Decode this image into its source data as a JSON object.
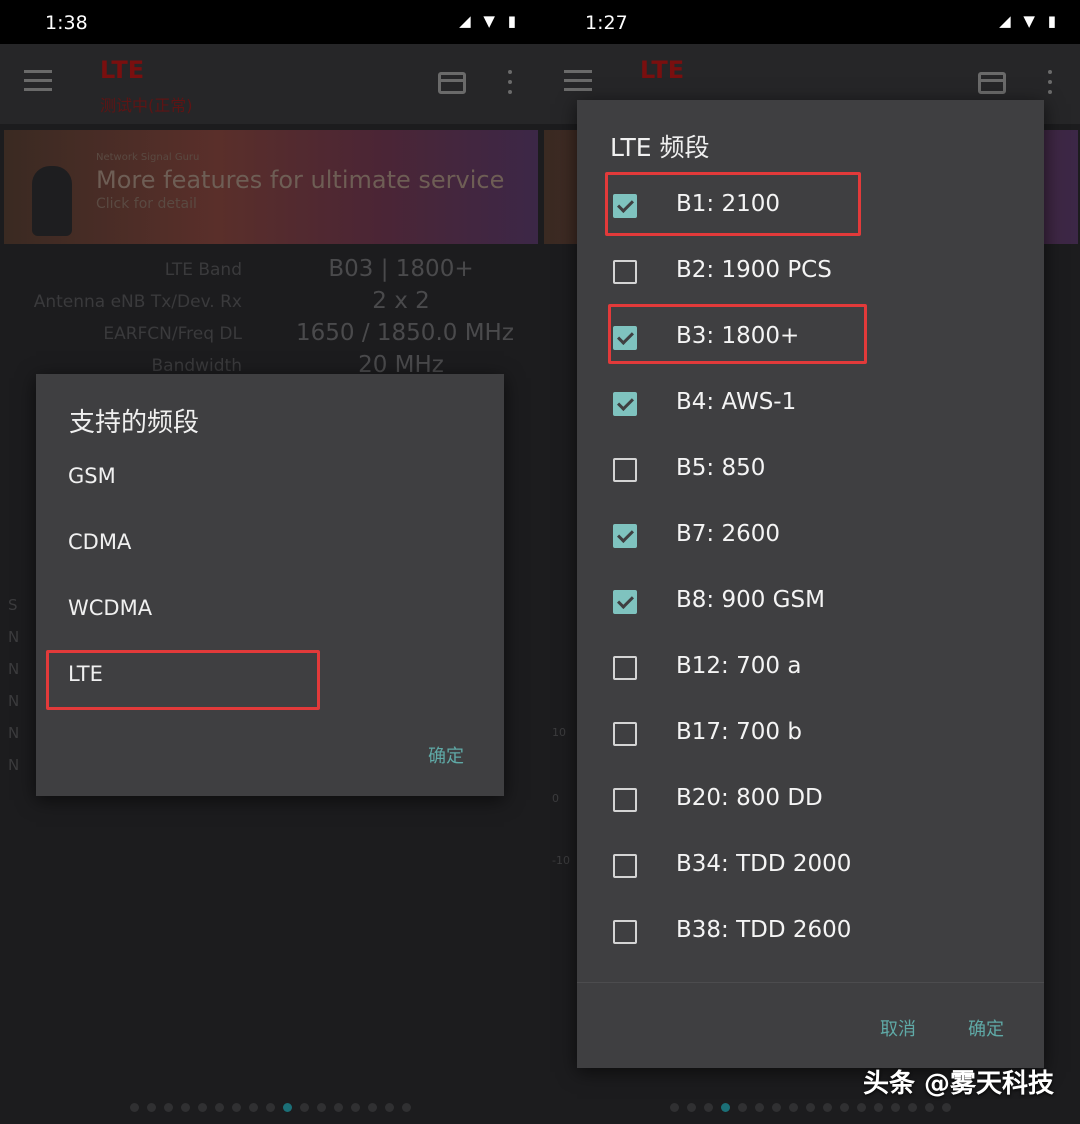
{
  "left": {
    "status": {
      "time": "1:38",
      "icons": "◢ ▼ ▮"
    },
    "appbar": {
      "title": "LTE",
      "subtitle": "测试中(正常)"
    },
    "banner": {
      "small": "Network Signal Guru",
      "main": "More features for ultimate service",
      "sub": "Click for detail"
    },
    "stats": [
      {
        "label": "LTE Band",
        "value": "B03 | 1800+"
      },
      {
        "label": "Antenna eNB Tx/Dev. Rx",
        "value": "2 x 2"
      },
      {
        "label": "EARFCN/Freq DL",
        "value": "1650 / 1850.0 MHz"
      },
      {
        "label": "Bandwidth",
        "value": "20 MHz"
      }
    ],
    "side_letters": [
      "S",
      "N",
      "N",
      "N",
      "N",
      "N"
    ],
    "dialog": {
      "title": "支持的频段",
      "options": [
        "GSM",
        "CDMA",
        "WCDMA",
        "LTE"
      ],
      "confirm": "确定"
    }
  },
  "right": {
    "status": {
      "time": "1:27",
      "icons": "◢ ▼ ▮"
    },
    "appbar": {
      "title": "LTE"
    },
    "chart_ticks": [
      "10",
      "0",
      "-10"
    ],
    "dialog": {
      "title": "LTE 频段",
      "bands": [
        {
          "label": "B1: 2100",
          "checked": true
        },
        {
          "label": "B2: 1900 PCS",
          "checked": false
        },
        {
          "label": "B3: 1800+",
          "checked": true
        },
        {
          "label": "B4: AWS-1",
          "checked": true
        },
        {
          "label": "B5: 850",
          "checked": false
        },
        {
          "label": "B7: 2600",
          "checked": true
        },
        {
          "label": "B8: 900 GSM",
          "checked": true
        },
        {
          "label": "B12: 700 a",
          "checked": false
        },
        {
          "label": "B17: 700 b",
          "checked": false
        },
        {
          "label": "B20: 800 DD",
          "checked": false
        },
        {
          "label": "B34: TDD 2000",
          "checked": false
        },
        {
          "label": "B38: TDD 2600",
          "checked": false
        }
      ],
      "cancel": "取消",
      "confirm": "确定"
    }
  },
  "watermark": "头条 @雾天科技",
  "colors": {
    "accent": "#5fa9a6",
    "checkbox": "#7fc3bf",
    "highlight": "#e23a3a",
    "dialog_bg": "#3f3f41",
    "page_indicator": "#1b6f77"
  }
}
